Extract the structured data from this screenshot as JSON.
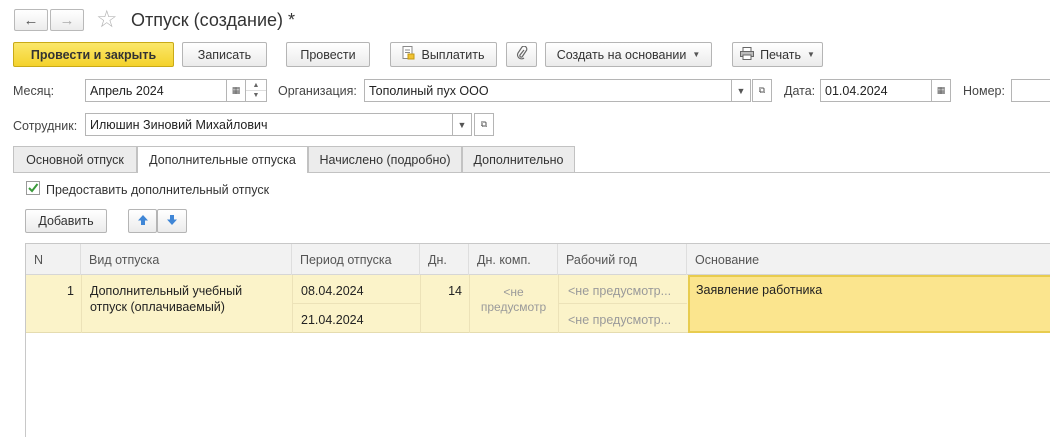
{
  "window": {
    "title": "Отпуск (создание) *",
    "nav_back": "←",
    "nav_forward": "→",
    "star": "☆"
  },
  "toolbar": {
    "post_and_close": "Провести и закрыть",
    "save": "Записать",
    "post": "Провести",
    "pay": "Выплатить",
    "create_based_on": "Создать на основании",
    "print": "Печать"
  },
  "header": {
    "month_label": "Месяц:",
    "month_value": "Апрель 2024",
    "org_label": "Организация:",
    "org_value": "Тополиный пух ООО",
    "date_label": "Дата:",
    "date_value": "01.04.2024",
    "number_label": "Номер:",
    "number_value": "",
    "employee_label": "Сотрудник:",
    "employee_value": "Илюшин Зиновий Михайлович"
  },
  "tabs": [
    {
      "label": "Основной отпуск",
      "active": false
    },
    {
      "label": "Дополнительные отпуска",
      "active": true
    },
    {
      "label": "Начислено (подробно)",
      "active": false
    },
    {
      "label": "Дополнительно",
      "active": false
    }
  ],
  "additional": {
    "checkbox_label": "Предоставить дополнительный отпуск",
    "checkbox_checked": true,
    "add_button": "Добавить"
  },
  "table": {
    "columns": [
      "N",
      "Вид отпуска",
      "Период отпуска",
      "Дн.",
      "Дн. комп.",
      "Рабочий год",
      "Основание"
    ],
    "rows": [
      {
        "n": "1",
        "type_line1": "Дополнительный учебный",
        "type_line2": "отпуск (оплачиваемый)",
        "period_from": "08.04.2024",
        "period_to": "21.04.2024",
        "days": "14",
        "comp_days_line1": "<не",
        "comp_days_line2": "предусмотр",
        "work_year_from": "<не предусмотр...",
        "work_year_to": "<не предусмотр...",
        "basis": "Заявление работника"
      }
    ]
  },
  "colors": {
    "primary_button": "#f4d22c",
    "row_highlight": "#fbf3c9",
    "active_cell": "#fbe58e",
    "checkbox_mark": "#3a9a3a",
    "arrow_blue": "#3f86d6"
  }
}
